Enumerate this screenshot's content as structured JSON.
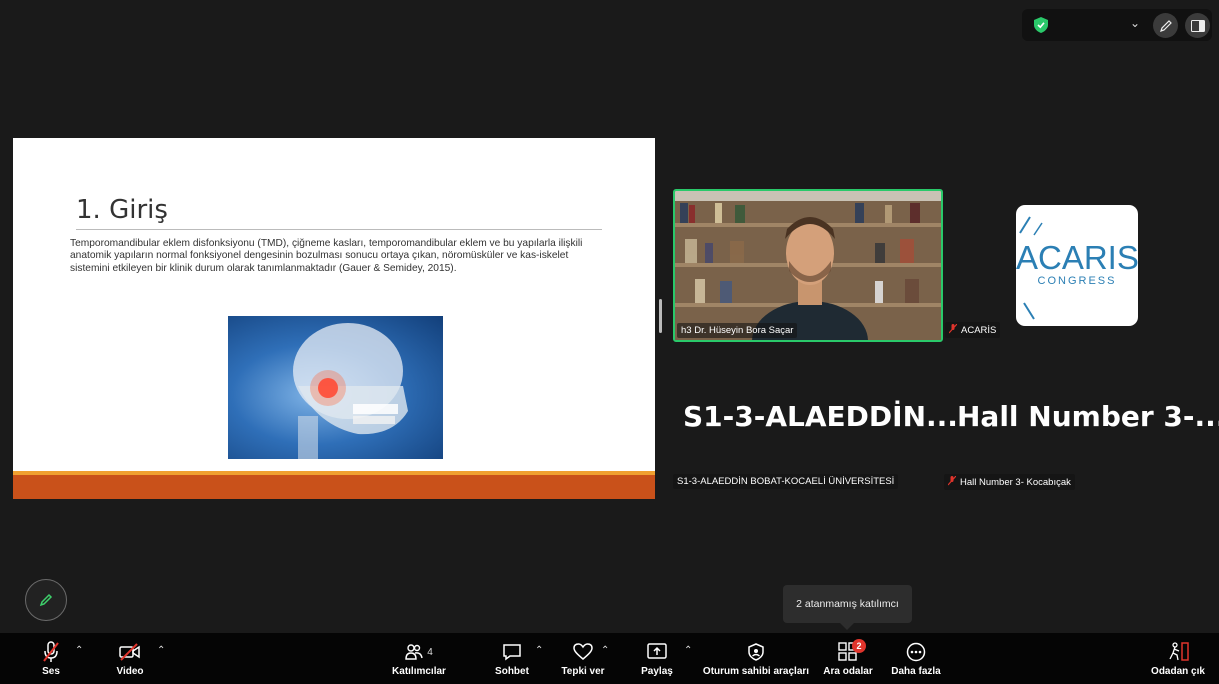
{
  "slide": {
    "title": "1. Giriş",
    "body": "Temporomandibular eklem disfonksiyonu (TMD), çiğneme kasları, temporomandibular eklem ve bu yapılarla ilişkili anatomik yapıların normal fonksiyonel dengesinin bozulması sonucu ortaya çıkan, nöromüsküler ve kas-iskelet sistemini etkileyen bir klinik durum olarak tanımlanmaktadır (Gauer & Semidey, 2015)."
  },
  "participants": {
    "video_name": "h3 Dr. Hüseyin Bora Saçar",
    "logo_name": "ACARİS",
    "logo_main": "ACARIS",
    "logo_sub": "CONGRESS",
    "tile3_big": "S1-3-ALAEDDİN...",
    "tile3_name": "S1-3-ALAEDDİN BOBAT-KOCAELİ ÜNİVERSİTESİ",
    "tile4_big": "Hall Number 3-...",
    "tile4_name": "Hall Number 3- Kocabıçak"
  },
  "tooltip": "2 atanmamış katılımcı",
  "toolbar": {
    "audio": "Ses",
    "video": "Video",
    "participants": "Katılımcılar",
    "participants_count": "4",
    "chat": "Sohbet",
    "react": "Tepki ver",
    "share": "Paylaş",
    "host_tools": "Oturum sahibi araçları",
    "breakout": "Ara odalar",
    "breakout_badge": "2",
    "more": "Daha fazla",
    "leave": "Odadan çık"
  },
  "colors": {
    "active_speaker": "#2ac96a",
    "slide_accent": "#c9511a",
    "badge": "#e0342c",
    "muted_red": "#e0342c"
  }
}
